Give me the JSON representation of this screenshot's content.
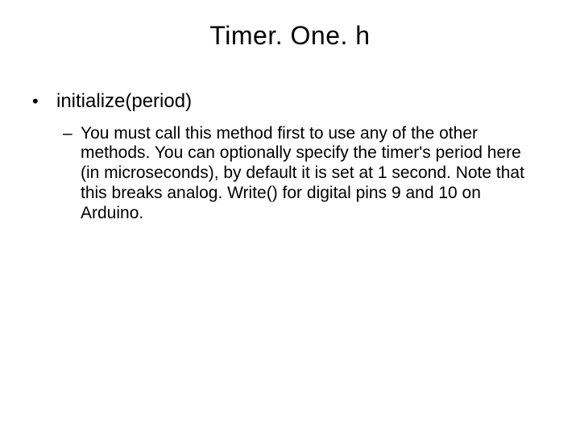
{
  "slide": {
    "title": "Timer. One. h",
    "bullets": [
      {
        "level": 1,
        "marker": "•",
        "text": "initialize(period)"
      },
      {
        "level": 2,
        "marker": "–",
        "text": "You must call this method first to use any of the other methods. You can optionally specify the timer's period here (in microseconds), by default it is set at 1 second. Note that this breaks analog. Write() for digital pins 9 and 10 on Arduino."
      }
    ]
  }
}
